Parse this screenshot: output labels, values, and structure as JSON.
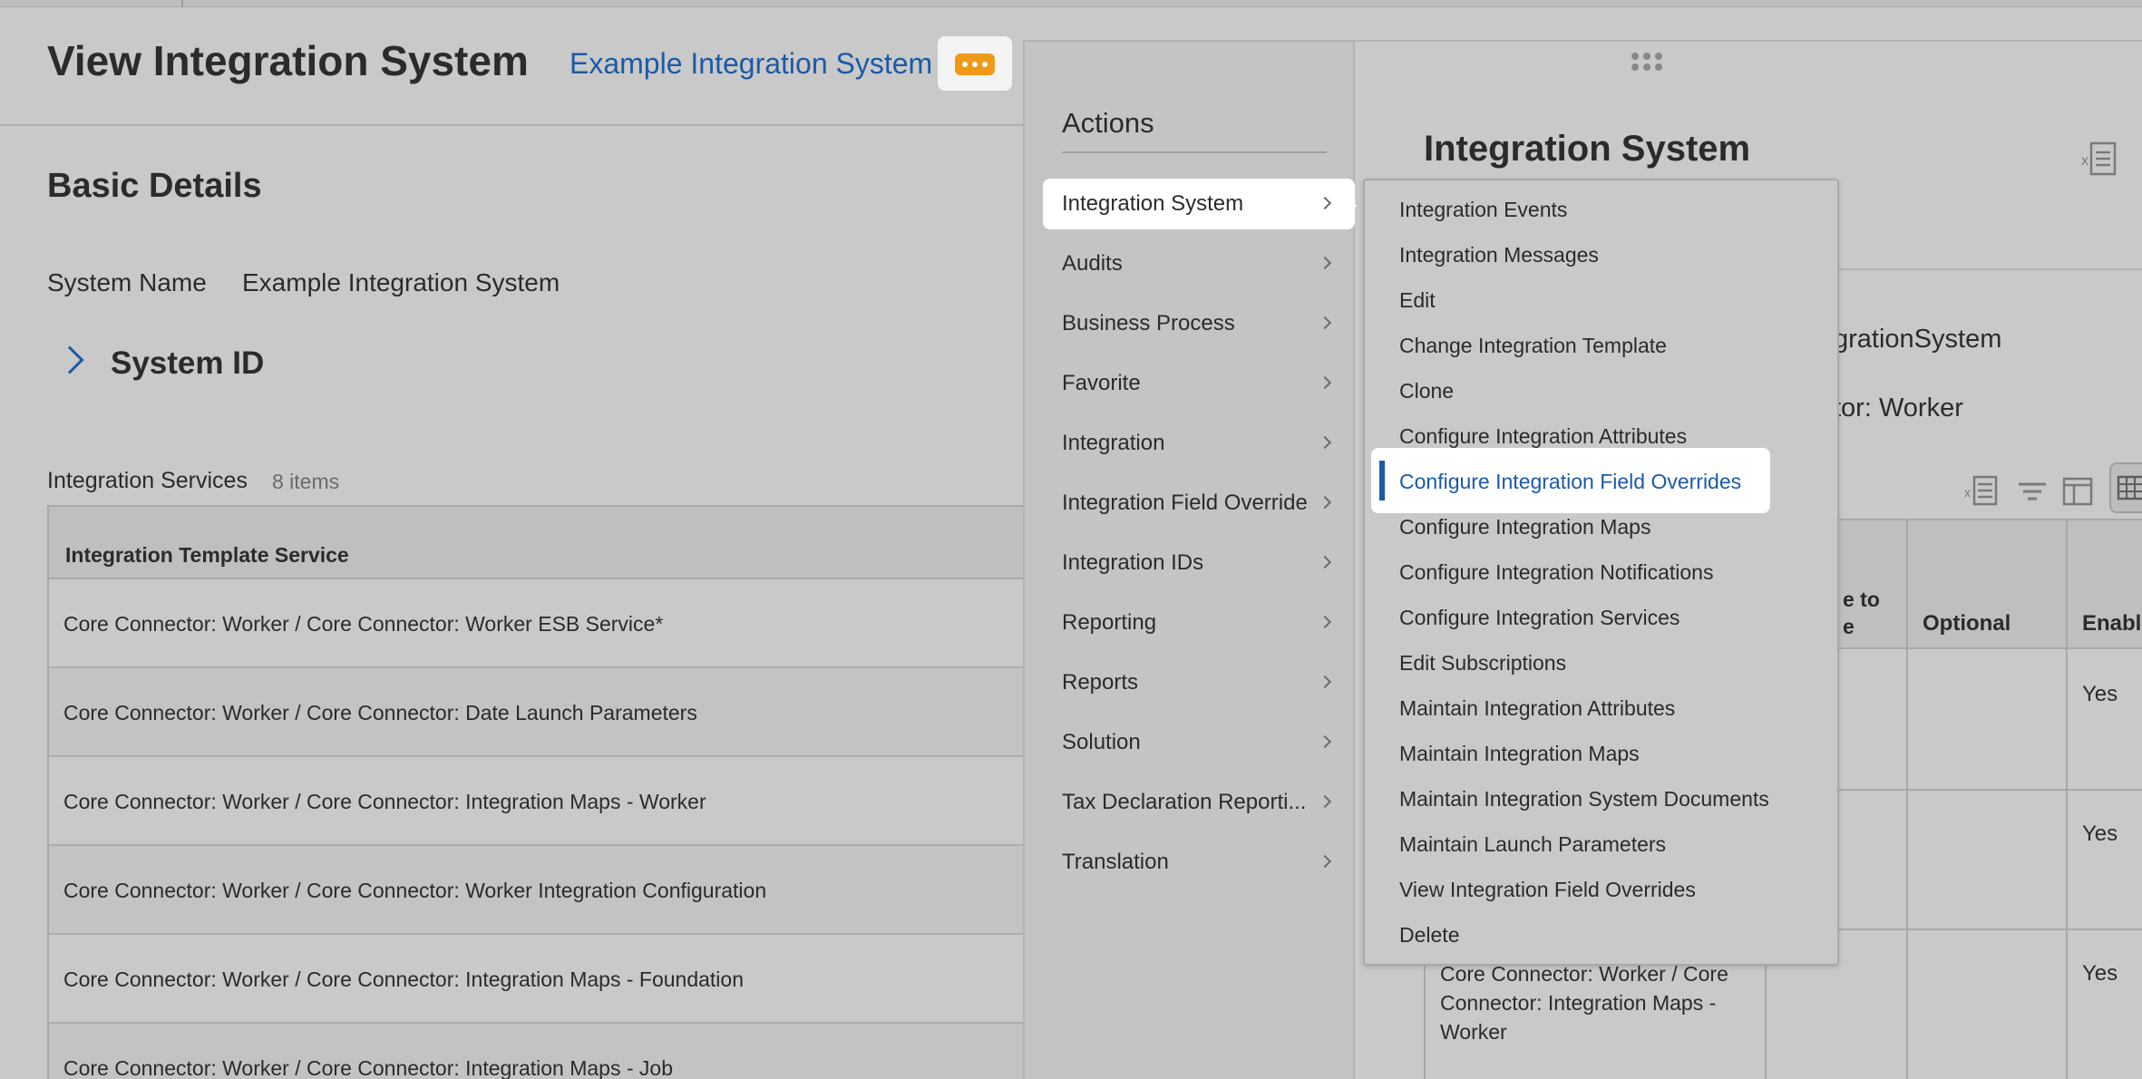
{
  "page": {
    "title": "View Integration System",
    "title_link": "Example Integration System",
    "related_actions_icon": "more-dots-icon"
  },
  "basic_details": {
    "heading": "Basic Details",
    "system_name_label": "System Name",
    "system_name_value": "Example Integration System",
    "system_id_heading": "System ID"
  },
  "services_grid": {
    "title": "Integration Services",
    "count": "8 items",
    "column_header": "Integration Template Service",
    "rows": [
      "Core Connector: Worker / Core Connector: Worker ESB Service*",
      "Core Connector: Worker / Core Connector: Date Launch Parameters",
      "Core Connector: Worker / Core Connector: Integration Maps - Worker",
      "Core Connector: Worker / Core Connector: Worker Integration Configuration",
      "Core Connector: Worker / Core Connector: Integration Maps - Foundation",
      "Core Connector: Worker / Core Connector: Integration Maps - Job"
    ]
  },
  "actions_menu": {
    "title": "Actions",
    "items": [
      "Integration System",
      "Audits",
      "Business Process",
      "Favorite",
      "Integration",
      "Integration Field Override",
      "Integration IDs",
      "Reporting",
      "Reports",
      "Solution",
      "Tax Declaration Reporti...",
      "Translation"
    ],
    "active_item": "Integration System"
  },
  "submenu": {
    "items": [
      "Integration Events",
      "Integration Messages",
      "Edit",
      "Change Integration Template",
      "Clone",
      "Configure Integration Attributes",
      "Configure Integration Field Overrides",
      "Configure Integration Maps",
      "Configure Integration Notifications",
      "Configure Integration Services",
      "Edit Subscriptions",
      "Maintain Integration Attributes",
      "Maintain Integration Maps",
      "Maintain Integration System Documents",
      "Maintain Launch Parameters",
      "View Integration Field Overrides",
      "Delete"
    ],
    "highlighted_item": "Configure Integration Field Overrides"
  },
  "side_panel": {
    "title": "Integration System",
    "text_line1": "grationSystem",
    "text_line2": "tor: Worker",
    "header_partial_line1": "e to",
    "header_partial_line2": "e",
    "header_optional": "Optional",
    "header_enabled": "Enable",
    "yes_values": [
      "Yes",
      "Yes",
      "Yes"
    ],
    "cell_text": "Core Connector: Worker / Core Connector: Integration Maps - Worker"
  },
  "colors": {
    "link": "#1c5aa6",
    "accent_orange": "#ee9a18",
    "overlay_gray": "#c9c9c9"
  }
}
